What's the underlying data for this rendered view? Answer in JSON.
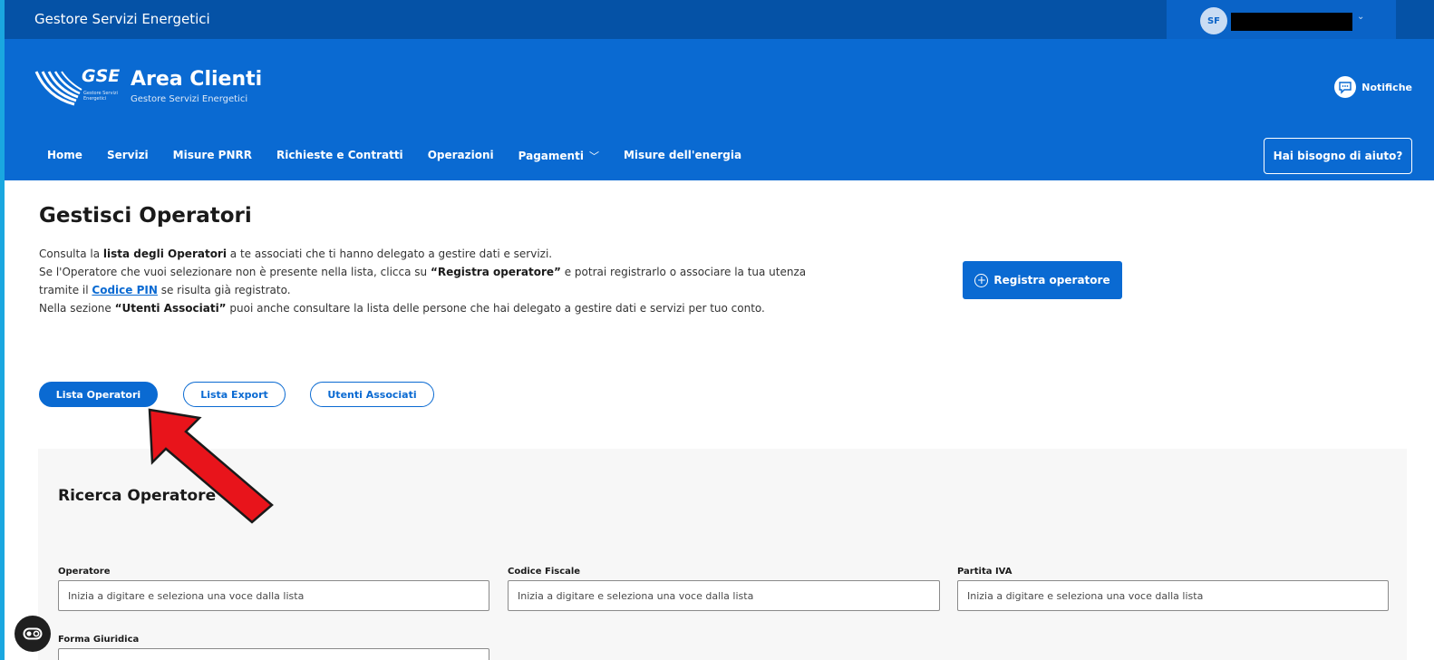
{
  "topbar": {
    "brand": "Gestore Servizi Energetici",
    "user_initials": "SF"
  },
  "header": {
    "logo_text": "GSE",
    "logo_small": "Gestore Servizi Energetici",
    "title": "Area Clienti",
    "subtitle": "Gestore Servizi Energetici",
    "notifications_label": "Notifiche",
    "help_label": "Hai bisogno di aiuto?"
  },
  "nav": {
    "items": [
      "Home",
      "Servizi",
      "Misure PNRR",
      "Richieste e Contratti",
      "Operazioni",
      "Pagamenti",
      "Misure dell'energia"
    ]
  },
  "page": {
    "title": "Gestisci Operatori",
    "desc": {
      "l1_a": "Consulta la ",
      "l1_b": "lista degli Operatori",
      "l1_c": " a te associati che ti hanno delegato a gestire dati e servizi.",
      "l2_a": "Se l'Operatore che vuoi selezionare non è presente nella lista, clicca su ",
      "l2_b": "“Registra operatore”",
      "l2_c": " e potrai registrarlo o associare la tua utenza tramite il ",
      "l2_link": "Codice PIN",
      "l2_d": " se risulta già registrato.",
      "l3_a": "Nella sezione ",
      "l3_b": "“Utenti Associati”",
      "l3_c": " puoi anche consultare la lista delle persone che hai delegato a gestire dati e servizi per tuo conto."
    },
    "register_label": "Registra operatore",
    "tabs": [
      "Lista Operatori",
      "Lista Export",
      "Utenti Associati"
    ]
  },
  "search": {
    "title": "Ricerca Operatore",
    "fields": [
      {
        "label": "Operatore",
        "placeholder": "Inizia a digitare e seleziona una voce dalla lista"
      },
      {
        "label": "Codice Fiscale",
        "placeholder": "Inizia a digitare e seleziona una voce dalla lista"
      },
      {
        "label": "Partita IVA",
        "placeholder": "Inizia a digitare e seleziona una voce dalla lista"
      },
      {
        "label": "Forma Giuridica",
        "placeholder": ""
      }
    ]
  },
  "colors": {
    "brand_dark": "#0552a6",
    "brand": "#0a6ad2",
    "annotation_arrow": "#e8141b"
  },
  "icons": {
    "notifications": "chat-bubble-icon",
    "register": "plus-circle-icon",
    "pagamenti_dropdown": "chevron-down-icon",
    "cookie": "cookie-settings-icon",
    "annotation": "red-arrow-icon"
  }
}
